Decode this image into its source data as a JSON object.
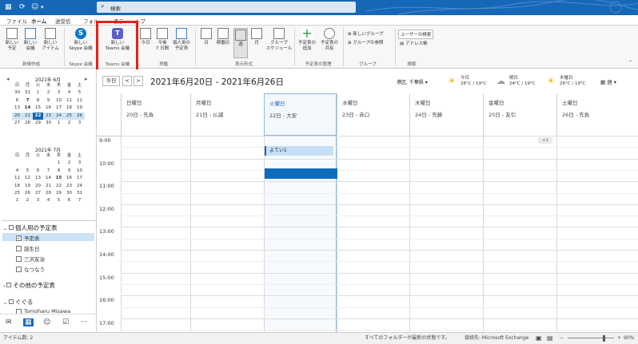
{
  "search": {
    "placeholder": "検索"
  },
  "tabs": [
    "ファイル",
    "ホーム",
    "送受信",
    "フォル",
    "",
    "表示",
    "ルプ"
  ],
  "ribbon": {
    "new_appointment": "新しい\n予定",
    "new_meeting": "新しい\n会議",
    "new_items": "新しい\nアイテム",
    "group_new": "新規作成",
    "skype_meeting": "新しい\nSkype 会議",
    "group_skype": "Skype 会議",
    "teams_meeting": "新しい\nTeams 会議",
    "group_teams": "Teams 会議",
    "today": "今日",
    "next7": "今後\n7 日間",
    "personal_cal": "個人用の\n予定表",
    "group_move": "移動",
    "day": "日",
    "workweek": "稼働日",
    "week": "週",
    "month": "月",
    "schedule": "グループ\nスケジュール",
    "group_view": "表示形式",
    "add_cal": "予定表の\n追加",
    "share_cal": "予定表の\n共有",
    "group_manage": "予定表の管理",
    "new_group": "新しいグループ",
    "browse_groups": "グループの参照",
    "group_groups": "グループ",
    "user_search": "ユーザーの検索",
    "address_book": "アドレス帳",
    "group_search": "検索"
  },
  "minical_june": {
    "title": "2021年 6月",
    "weekdays": [
      "日",
      "月",
      "火",
      "水",
      "木",
      "金",
      "土"
    ],
    "days": [
      "30",
      "31",
      "1",
      "2",
      "3",
      "4",
      "5",
      "6",
      "7",
      "8",
      "9",
      "10",
      "11",
      "12",
      "13",
      "14",
      "15",
      "16",
      "17",
      "18",
      "19",
      "20",
      "21",
      "22",
      "23",
      "24",
      "25",
      "26",
      "27",
      "28",
      "29",
      "30",
      "1",
      "2",
      "3"
    ]
  },
  "minical_july": {
    "title": "2021年 7月",
    "weekdays": [
      "日",
      "月",
      "火",
      "水",
      "木",
      "金",
      "土"
    ],
    "days": [
      "",
      "",
      "",
      "",
      "1",
      "2",
      "3",
      "4",
      "5",
      "6",
      "7",
      "8",
      "9",
      "10",
      "11",
      "12",
      "13",
      "14",
      "15",
      "16",
      "17",
      "18",
      "19",
      "20",
      "21",
      "22",
      "23",
      "24",
      "25",
      "26",
      "27",
      "28",
      "29",
      "30",
      "31",
      "1",
      "2",
      "3",
      "4",
      "5",
      "6",
      "7"
    ]
  },
  "calendars": {
    "section_personal": "個人用の予定表",
    "items": [
      "予定表",
      "誕生日",
      "三沢友治",
      "なつなう"
    ],
    "section_other": "その他の予定表",
    "section_group": "ぐぐる",
    "group_member": "Tomoharu Misawa"
  },
  "header": {
    "today_btn": "今日",
    "prev": "<",
    "next": ">",
    "range": "2021年6月20日 - 2021年6月26日",
    "location": "港区, 千葉県 ▾",
    "weather": [
      {
        "day": "今日",
        "temp": "26°C / 19°C",
        "icon": "partly-cloudy-icon"
      },
      {
        "day": "明日",
        "temp": "24°C / 19°C",
        "icon": "cloud-icon"
      },
      {
        "day": "木曜日",
        "temp": "26°C / 19°C",
        "icon": "sun-icon"
      }
    ],
    "view_label": "週 ▾"
  },
  "days": [
    {
      "name": "日曜日",
      "date": "20日 - 先負"
    },
    {
      "name": "月曜日",
      "date": "21日 - 仏滅"
    },
    {
      "name": "火曜日",
      "date": "22日 - 大安"
    },
    {
      "name": "水曜日",
      "date": "23日 - 赤口"
    },
    {
      "name": "木曜日",
      "date": "24日 - 先勝"
    },
    {
      "name": "金曜日",
      "date": "25日 - 友引"
    },
    {
      "name": "土曜日",
      "date": "26日 - 先負"
    }
  ],
  "more_badge": "+1",
  "hours": [
    "9:00",
    "10:00",
    "11:00",
    "12:00",
    "13:00",
    "14:00",
    "15:00",
    "16:00",
    "17:00"
  ],
  "event": {
    "title": "よてい1"
  },
  "status": {
    "items": "アイテム数: 2",
    "sync": "すべてのフォルダーが最新の状態です。",
    "connection": "接続先: Microsoft Exchange",
    "zoom": "90%"
  },
  "colors": {
    "accent": "#1667b7",
    "highlight": "#e32119",
    "teams": "#5b5fc7",
    "skype": "#0078d4",
    "now": "#0f6cbd"
  }
}
